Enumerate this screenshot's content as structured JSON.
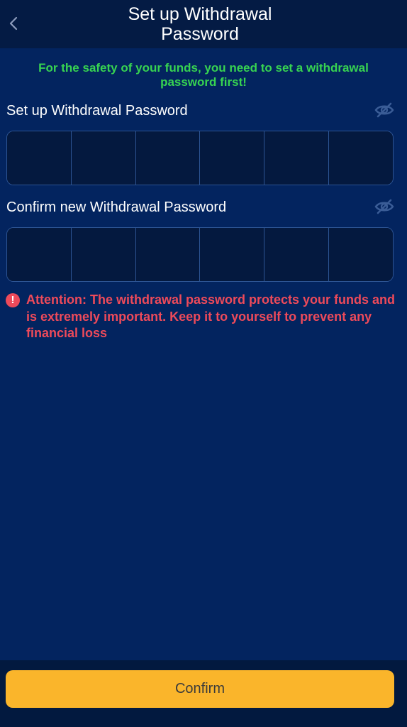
{
  "header": {
    "title": "Set up Withdrawal Password",
    "back_icon": "chevron-left-icon"
  },
  "notice": "For the safety of your funds, you need to set a withdrawal password first!",
  "fields": [
    {
      "label": "Set up Withdrawal Password",
      "visibility_icon": "eye-off-icon",
      "digits": 6
    },
    {
      "label": "Confirm new Withdrawal Password",
      "visibility_icon": "eye-off-icon",
      "digits": 6
    }
  ],
  "attention": {
    "icon": "exclamation-circle-icon",
    "icon_glyph": "!",
    "text": "Attention: The withdrawal password protects your funds and is extremely important. Keep it to yourself to prevent any financial loss"
  },
  "confirm_button": {
    "label": "Confirm"
  },
  "colors": {
    "background": "#03245f",
    "header": "#041b44",
    "notice": "#37d351",
    "warning": "#ee4a5a",
    "button": "#fab52b",
    "button_text": "#3b3b3b",
    "input_border": "#2d5493"
  }
}
